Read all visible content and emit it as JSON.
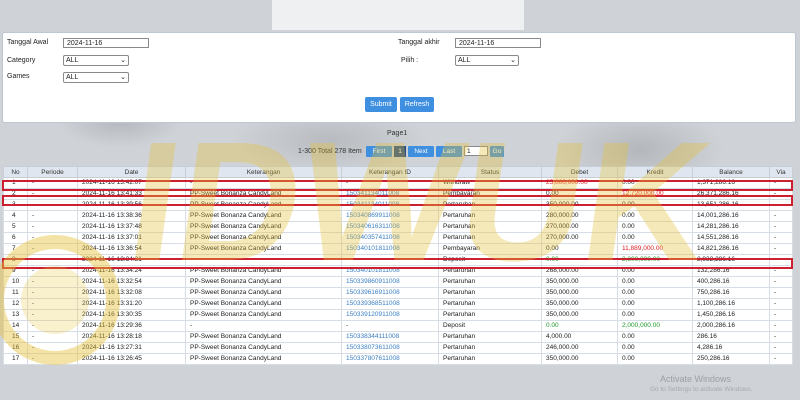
{
  "filters": {
    "tanggal_awal_label": "Tanggal Awal",
    "tanggal_awal_value": "2024-11-16",
    "tanggal_akhir_label": "Tanggal akhir",
    "tanggal_akhir_value": "2024-11-16",
    "category_label": "Category",
    "category_value": "ALL",
    "pilih_label": "Pilih :",
    "pilih_value": "ALL",
    "games_label": "Games",
    "games_value": "ALL",
    "submit_label": "Submit",
    "refresh_label": "Refresh"
  },
  "pager": {
    "page_label": "Page1",
    "range_label": "1-300 Total 278 Item",
    "first": "First",
    "current": "1",
    "next": "Next",
    "last": "Last",
    "page_input": "1",
    "go": "Go"
  },
  "table": {
    "headers": [
      "No",
      "Periode",
      "Date",
      "Keterangan",
      "Keterangan ID",
      "Status",
      "Debet",
      "Kredit",
      "Balance",
      "Via"
    ],
    "rows": [
      [
        "1",
        "-",
        "2024-11-16 13:42:07",
        "-",
        "-",
        "Withdraw",
        "25,000,000.00",
        "0.00",
        "1,371,286.16",
        "-"
      ],
      [
        "2",
        "-",
        "2024-11-16 13:41:33",
        "PP-Sweet Bonanza CandyLand",
        "150341134011008",
        "Pembayaran",
        "0.00",
        "12,720,000.00",
        "26,371,286.16",
        "-"
      ],
      [
        "3",
        "-",
        "2024-11-16 13:39:56",
        "PP-Sweet Bonanza CandyLand",
        "150341134011008",
        "Pertaruhan",
        "350,000.00",
        "0.00",
        "13,651,286.16",
        "-"
      ],
      [
        "4",
        "-",
        "2024-11-16 13:38:36",
        "PP-Sweet Bonanza CandyLand",
        "150340869911008",
        "Pertaruhan",
        "280,000.00",
        "0.00",
        "14,001,286.16",
        "-"
      ],
      [
        "5",
        "-",
        "2024-11-16 13:37:48",
        "PP-Sweet Bonanza CandyLand",
        "150340616311008",
        "Pertaruhan",
        "270,000.00",
        "0.00",
        "14,281,286.16",
        "-"
      ],
      [
        "6",
        "-",
        "2024-11-16 13:37:01",
        "PP-Sweet Bonanza CandyLand",
        "150340357411008",
        "Pertaruhan",
        "270,000.00",
        "0.00",
        "14,551,286.16",
        "-"
      ],
      [
        "7",
        "-",
        "2024-11-16 13:36:54",
        "PP-Sweet Bonanza CandyLand",
        "150340101811008",
        "Pembayaran",
        "0.00",
        "11,889,000.00",
        "14,821,286.16",
        "-"
      ],
      [
        "8",
        "-",
        "2024-11-16 13:34:31",
        "-",
        "-",
        "Deposit",
        "0.00",
        "2,800,000.00",
        "2,932,286.16",
        "-"
      ],
      [
        "9",
        "-",
        "2024-11-16 13:34:24",
        "PP-Sweet Bonanza CandyLand",
        "150340101811008",
        "Pertaruhan",
        "268,000.00",
        "0.00",
        "132,286.16",
        "-"
      ],
      [
        "10",
        "-",
        "2024-11-16 13:32:54",
        "PP-Sweet Bonanza CandyLand",
        "150339860911008",
        "Pertaruhan",
        "350,000.00",
        "0.00",
        "400,286.16",
        "-"
      ],
      [
        "11",
        "-",
        "2024-11-16 13:32:08",
        "PP-Sweet Bonanza CandyLand",
        "150339616911008",
        "Pertaruhan",
        "350,000.00",
        "0.00",
        "750,286.16",
        "-"
      ],
      [
        "12",
        "-",
        "2024-11-16 13:31:20",
        "PP-Sweet Bonanza CandyLand",
        "150339368511008",
        "Pertaruhan",
        "350,000.00",
        "0.00",
        "1,100,286.16",
        "-"
      ],
      [
        "13",
        "-",
        "2024-11-16 13:30:35",
        "PP-Sweet Bonanza CandyLand",
        "150339120911008",
        "Pertaruhan",
        "350,000.00",
        "0.00",
        "1,450,286.16",
        "-"
      ],
      [
        "14",
        "-",
        "2024-11-16 13:29:36",
        "-",
        "-",
        "Deposit",
        "0.00",
        "2,000,000.00",
        "2,000,286.16",
        "-"
      ],
      [
        "15",
        "-",
        "2024-11-16 13:28:18",
        "PP-Sweet Bonanza CandyLand",
        "150338344111008",
        "Pertaruhan",
        "4,000.00",
        "0.00",
        "286.16",
        "-"
      ],
      [
        "16",
        "-",
        "2024-11-16 13:27:31",
        "PP-Sweet Bonanza CandyLand",
        "150338073611008",
        "Pertaruhan",
        "246,000.00",
        "0.00",
        "4,286.16",
        "-"
      ],
      [
        "17",
        "-",
        "2024-11-16 13:26:45",
        "PP-Sweet Bonanza CandyLand",
        "150337807611008",
        "Pertaruhan",
        "350,000.00",
        "0.00",
        "250,286.16",
        "-"
      ]
    ]
  },
  "watermark": {
    "activate_title": "Activate Windows",
    "activate_sub": "Go to Settings to activate Windows.",
    "logo_text": "IDWUK"
  },
  "colors": {
    "accent": "#3f8fe0",
    "highlight": "#cc1f2f",
    "debit_red": "#e02020",
    "credit_green": "#1e9b2a"
  }
}
